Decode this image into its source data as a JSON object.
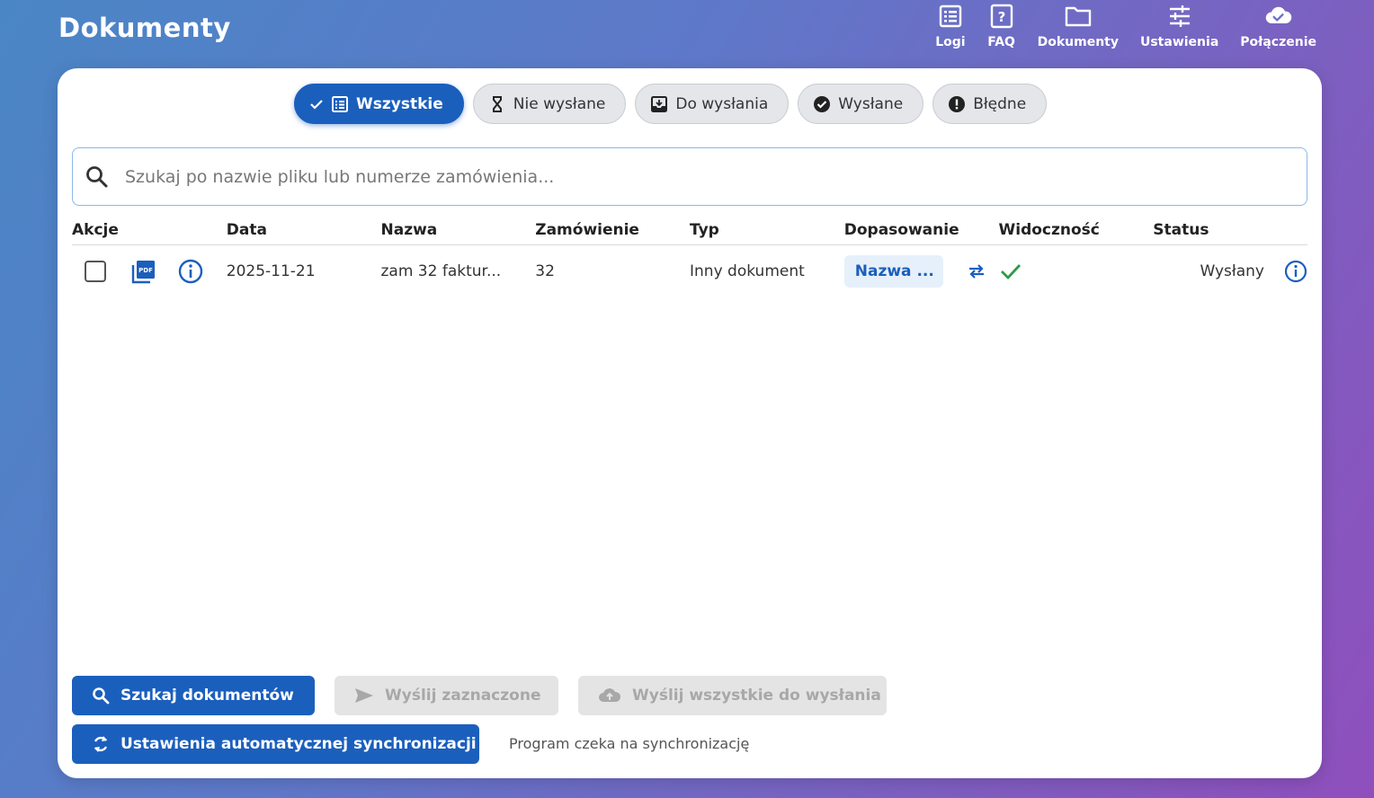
{
  "header": {
    "title": "Dokumenty"
  },
  "nav": [
    {
      "label": "Logi",
      "icon": "list-icon"
    },
    {
      "label": "FAQ",
      "icon": "help-icon"
    },
    {
      "label": "Dokumenty",
      "icon": "folder-icon"
    },
    {
      "label": "Ustawienia",
      "icon": "sliders-icon"
    },
    {
      "label": "Połączenie",
      "icon": "cloud-check-icon"
    }
  ],
  "filters": {
    "all": "Wszystkie",
    "not_sent": "Nie wysłane",
    "to_send": "Do wysłania",
    "sent": "Wysłane",
    "error": "Błędne",
    "active": "all"
  },
  "search": {
    "placeholder": "Szukaj po nazwie pliku lub numerze zamówienia..."
  },
  "table": {
    "columns": [
      "Akcje",
      "Data",
      "Nazwa",
      "Zamówienie",
      "Typ",
      "Dopasowanie",
      "Widoczność",
      "Status"
    ],
    "rows": [
      {
        "date": "2025-11-21",
        "name": "zam 32 faktur...",
        "order": "32",
        "type": "Inny dokument",
        "match": "Nazwa ...",
        "visible": true,
        "status": "Wysłany"
      }
    ]
  },
  "actions": {
    "search_docs": "Szukaj dokumentów",
    "send_selected": "Wyślij zaznaczone",
    "send_all": "Wyślij wszystkie do wysłania",
    "auto_sync": "Ustawienia automatycznej synchronizacji",
    "sync_status": "Program czeka na synchronizację"
  },
  "colors": {
    "primary": "#1b5fbd",
    "success": "#2e9b47",
    "disabled": "#e4e4e4"
  }
}
